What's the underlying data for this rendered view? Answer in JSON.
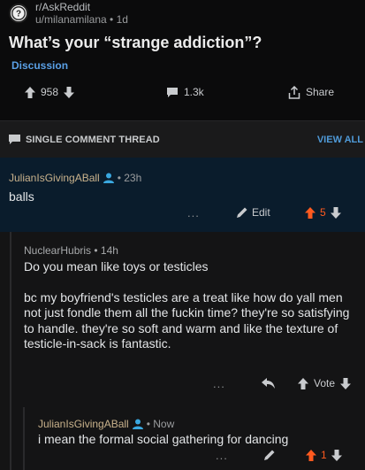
{
  "post": {
    "subreddit": "r/AskReddit",
    "user_line": "u/milanamilana • 1d",
    "title": "What’s your “strange addiction”?",
    "flair": "Discussion",
    "score": "958",
    "comments": "1.3k",
    "share_label": "Share"
  },
  "thread": {
    "label": "SINGLE COMMENT THREAD",
    "view_all": "VIEW ALL"
  },
  "comment1": {
    "author": "JulianIsGivingABall",
    "time": "• 23h",
    "body": "balls",
    "more": "...",
    "edit_label": "Edit",
    "score": "5"
  },
  "comment2": {
    "meta": "NuclearHubris • 14h",
    "para1": "Do you mean like toys or testicles",
    "para2": "bc my boyfriend's testicles are a treat like how do yall men not just fondle them all the fuckin time? they're so satisfying to handle. they're so soft and warm and like the texture of testicle-in-sack is fantastic.",
    "more": "...",
    "vote_label": "Vote"
  },
  "comment3": {
    "author": "JulianIsGivingABall",
    "time": "• Now",
    "body": "i mean the formal social gathering for dancing",
    "more": "...",
    "score": "1"
  },
  "colors": {
    "upvote_active": "#ff5a1f",
    "link_blue": "#4f9ad8",
    "highlight_bg": "#0a1c2c",
    "author_gold": "#c9b28c"
  }
}
